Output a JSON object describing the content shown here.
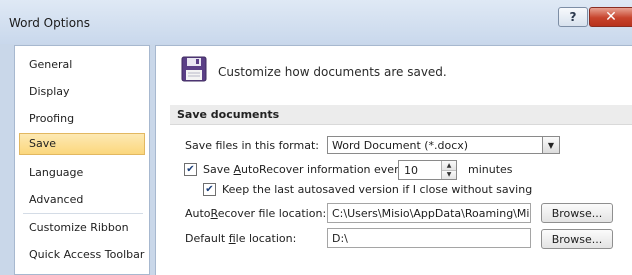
{
  "window": {
    "title": "Word Options",
    "help_label": "?",
    "close_label": "✕"
  },
  "sidebar": {
    "items": [
      {
        "label": "General",
        "selected": false
      },
      {
        "label": "Display",
        "selected": false
      },
      {
        "label": "Proofing",
        "selected": false
      },
      {
        "label": "Save",
        "selected": true
      },
      {
        "label": "Language",
        "selected": false
      },
      {
        "label": "Advanced",
        "selected": false
      },
      {
        "label": "Customize Ribbon",
        "selected": false
      },
      {
        "label": "Quick Access Toolbar",
        "selected": false
      }
    ]
  },
  "main": {
    "heading": "Customize how documents are saved.",
    "section_title": "Save documents",
    "save_format": {
      "label": "Save files in this format:",
      "value": "Word Document (*.docx)"
    },
    "autorecover": {
      "checked": true,
      "label_pre": "Save ",
      "label_u": "A",
      "label_post": "utoRecover information every",
      "minutes_value": "10",
      "minutes_label": "minutes"
    },
    "keep_last": {
      "checked": true,
      "label": "Keep the last autosaved version if I close without saving"
    },
    "autorecover_location": {
      "label_pre": "Auto",
      "label_u": "R",
      "label_post": "ecover file location:",
      "value": "C:\\Users\\Misio\\AppData\\Roaming\\Micr",
      "browse_label": "Browse..."
    },
    "default_location": {
      "label_pre": "Default ",
      "label_u": "f",
      "label_post": "ile location:",
      "value": "D:\\",
      "browse_label": "Browse..."
    }
  }
}
